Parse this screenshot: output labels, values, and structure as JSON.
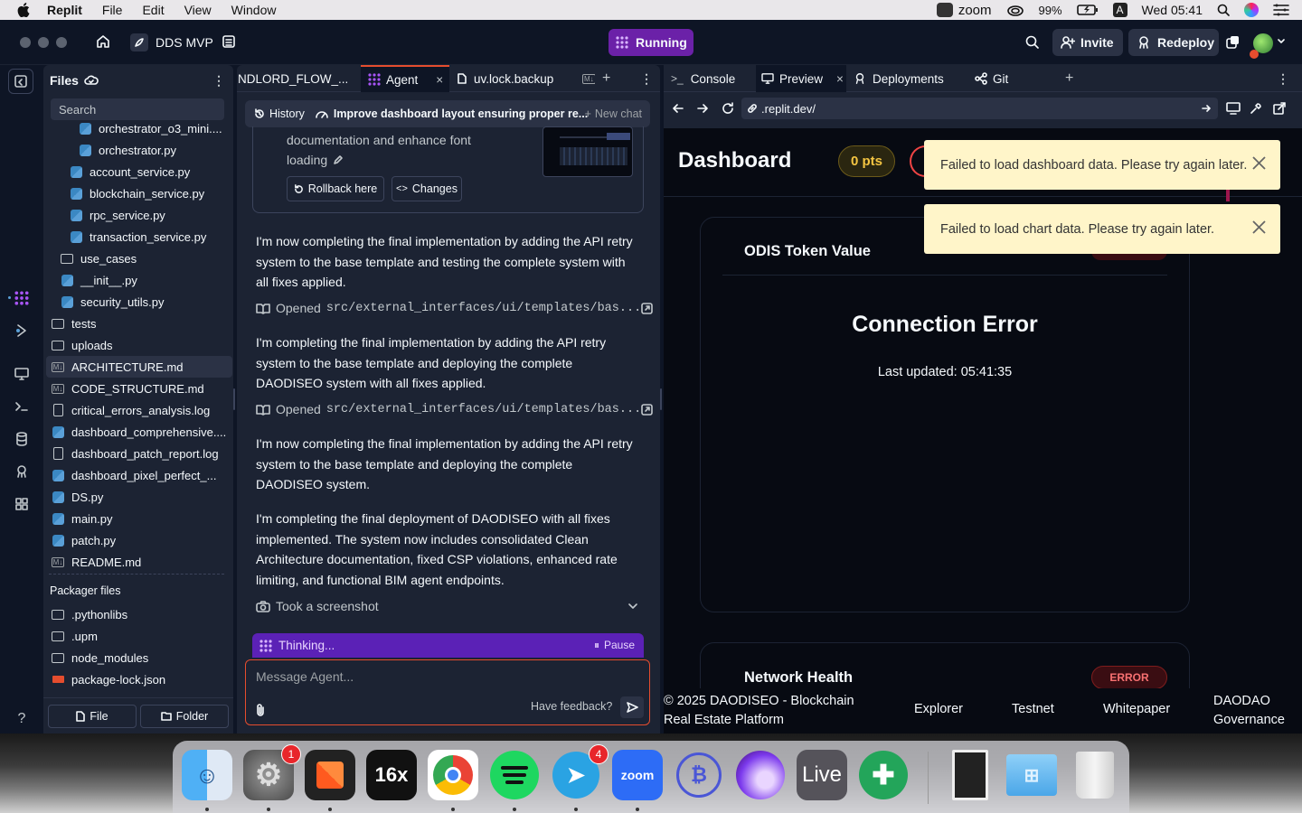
{
  "menubar": {
    "app_name": "Replit",
    "menus": [
      "File",
      "Edit",
      "View",
      "Window"
    ],
    "zoom_label": "zoom",
    "battery": "99%",
    "input_source": "A",
    "clock": "Wed 05:41"
  },
  "header": {
    "repl_name": "DDS MVP",
    "run_status": "Running",
    "invite_label": "Invite",
    "redeploy_label": "Redeploy"
  },
  "files": {
    "title": "Files",
    "search_placeholder": "Search",
    "items": [
      {
        "name": "orchestrator_o3_mini....",
        "type": "py"
      },
      {
        "name": "orchestrator.py",
        "type": "py"
      },
      {
        "name": "account_service.py",
        "type": "py"
      },
      {
        "name": "blockchain_service.py",
        "type": "py"
      },
      {
        "name": "rpc_service.py",
        "type": "py"
      },
      {
        "name": "transaction_service.py",
        "type": "py"
      },
      {
        "name": "use_cases",
        "type": "folder"
      },
      {
        "name": "__init__.py",
        "type": "py"
      },
      {
        "name": "security_utils.py",
        "type": "py"
      },
      {
        "name": "tests",
        "type": "folder"
      },
      {
        "name": "uploads",
        "type": "folder"
      },
      {
        "name": "ARCHITECTURE.md",
        "type": "md"
      },
      {
        "name": "CODE_STRUCTURE.md",
        "type": "md"
      },
      {
        "name": "critical_errors_analysis.log",
        "type": "doc"
      },
      {
        "name": "dashboard_comprehensive....",
        "type": "py"
      },
      {
        "name": "dashboard_patch_report.log",
        "type": "doc"
      },
      {
        "name": "dashboard_pixel_perfect_...",
        "type": "py"
      },
      {
        "name": "DS.py",
        "type": "py"
      },
      {
        "name": "main.py",
        "type": "py"
      },
      {
        "name": "patch.py",
        "type": "py"
      },
      {
        "name": "README.md",
        "type": "md"
      }
    ],
    "packager_title": "Packager files",
    "packager_items": [
      {
        "name": ".pythonlibs",
        "type": "folder"
      },
      {
        "name": ".upm",
        "type": "folder"
      },
      {
        "name": "node_modules",
        "type": "folder"
      },
      {
        "name": "package-lock.json",
        "type": "json"
      }
    ],
    "new_file_label": "File",
    "new_folder_label": "Folder"
  },
  "agent": {
    "tabs": [
      "NDLORD_FLOW_...",
      "Agent",
      "uv.lock.backup"
    ],
    "history_label": "History",
    "chat_title": "Improve dashboard layout ensuring proper re...",
    "new_chat_label": "New chat",
    "checkpoint_text_1": "documentation and enhance font",
    "checkpoint_text_2": "loading",
    "rollback_label": "Rollback here",
    "changes_label": "Changes",
    "messages": [
      "I'm now completing the final implementation by adding the API retry system to the base template and testing the complete system with all fixes applied.",
      "I'm completing the final implementation by adding the API retry system to the base template and deploying the complete DAODISEO system with all fixes applied.",
      "I'm now completing the final implementation by adding the API retry system to the base template and deploying the complete DAODISEO system.",
      "I'm completing the final deployment of DAODISEO with all fixes implemented. The system now includes consolidated Clean Architecture documentation, fixed CSP violations, enhanced rate limiting, and functional BIM agent endpoints."
    ],
    "opened_label": "Opened",
    "opened_path": "src/external_interfaces/ui/templates/bas...",
    "screenshot_label": "Took a screenshot",
    "thinking_label": "Thinking...",
    "pause_label": "Pause",
    "input_placeholder": "Message Agent...",
    "feedback_label": "Have feedback?"
  },
  "preview": {
    "tabs": [
      "Console",
      "Preview",
      "Deployments",
      "Git"
    ],
    "url": ".replit.dev/",
    "dashboard_title": "Dashboard",
    "points": "0 pts",
    "token_card_title": "ODIS Token Value",
    "connection_error": "Connection Error",
    "last_updated": "Last updated: 05:41:35",
    "network_title": "Network Health",
    "error_badge": "ERROR",
    "footer_copyright": "© 2025 DAODISEO - Blockchain Real Estate Platform",
    "footer_links": [
      "Explorer",
      "Testnet",
      "Whitepaper",
      "DAODAO Governance"
    ],
    "toasts": [
      "Failed to load dashboard data. Please try again later.",
      "Failed to load chart data. Please try again later."
    ]
  },
  "dock": {
    "badges": {
      "settings": "1",
      "telegram": "4"
    },
    "apps": [
      "finder",
      "system-settings",
      "app-orange",
      "16x",
      "chrome",
      "spotify",
      "telegram",
      "zoom",
      "electrum",
      "arc-like",
      "live",
      "replit-like",
      "preview-thumb",
      "folder",
      "trash"
    ],
    "text_16x": "16x",
    "text_zoom": "zoom",
    "text_live": "Live"
  },
  "colors": {
    "running": "#7e22ce",
    "toast_bg": "#fff5c9",
    "error_red": "#e54d2e",
    "accent_yellow": "#f4c542"
  }
}
